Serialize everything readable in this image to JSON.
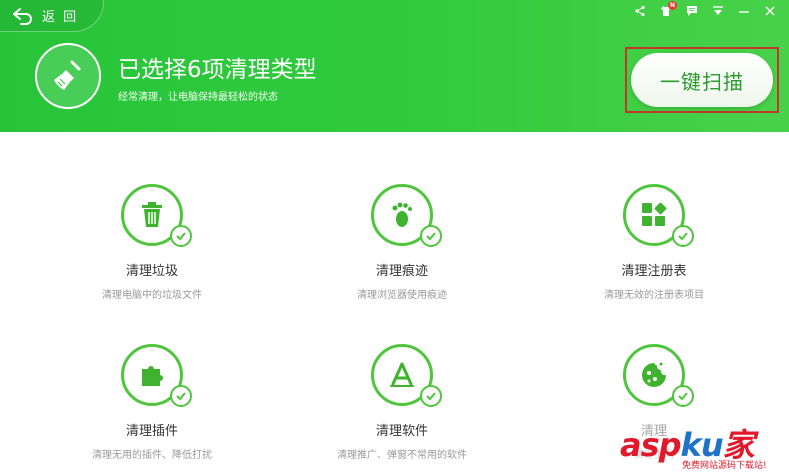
{
  "header": {
    "back_label": "返 回",
    "title": "已选择6项清理类型",
    "subtitle": "经常清理，让电脑保持最轻松的状态",
    "scan_button": "一键扫描",
    "notification_badge": "N"
  },
  "items": [
    {
      "title": "清理垃圾",
      "desc": "清理电脑中的垃圾文件",
      "icon": "trash-icon"
    },
    {
      "title": "清理痕迹",
      "desc": "清理浏览器使用痕迹",
      "icon": "footprint-icon"
    },
    {
      "title": "清理注册表",
      "desc": "清理无效的注册表项目",
      "icon": "registry-icon"
    },
    {
      "title": "清理插件",
      "desc": "清理无用的插件、降低打扰",
      "icon": "puzzle-icon"
    },
    {
      "title": "清理软件",
      "desc": "清理推广、弹窗不常用的软件",
      "icon": "app-store-icon"
    },
    {
      "title": "清理",
      "desc": "清理上网",
      "icon": "cookie-icon"
    }
  ],
  "watermark": {
    "asp": "asp",
    "ku": "ku",
    "jia": "家",
    "sub": "免费网站源码下载站!"
  },
  "colors": {
    "brand_green": "#32cb3c",
    "accent_green": "#4fc53e",
    "highlight_red": "#c0392b"
  }
}
